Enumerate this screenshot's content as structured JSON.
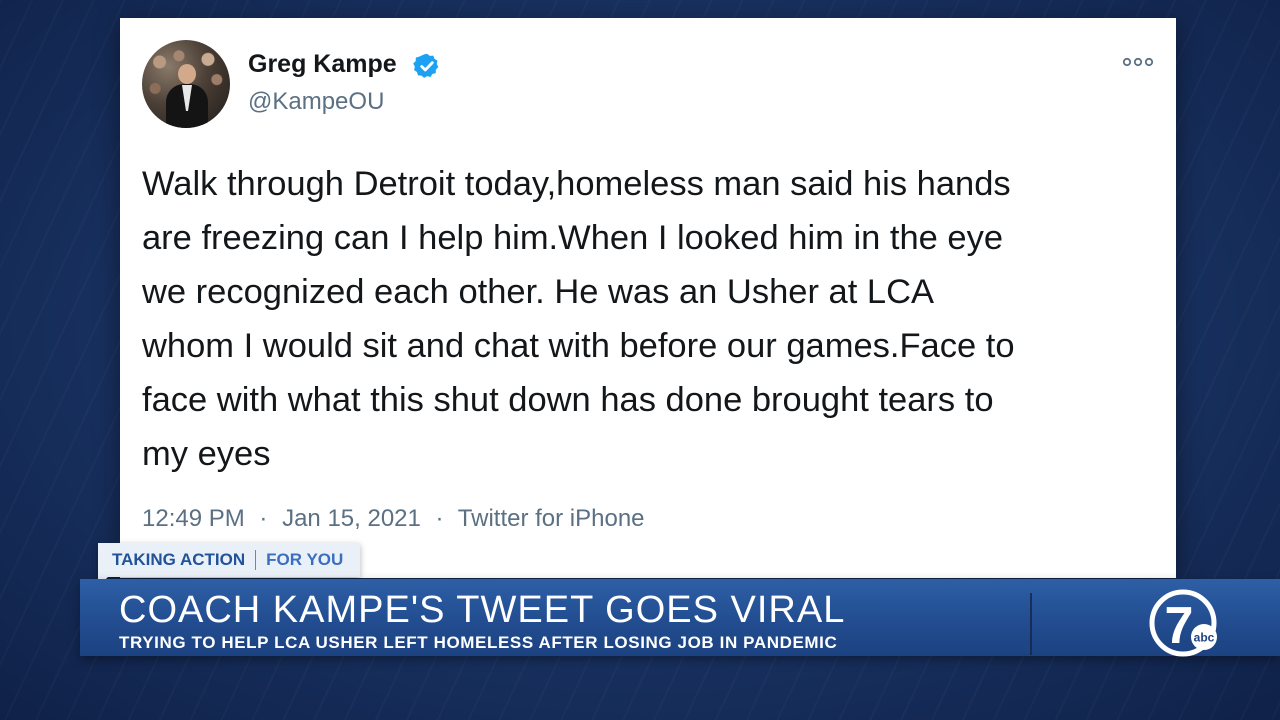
{
  "tweet": {
    "user_name": "Greg Kampe",
    "user_handle": "@KampeOU",
    "text": "Walk through Detroit today,homeless man said his hands\nare freezing can I help him.When I looked him in the eye\nwe recognized each other. He was an Usher at LCA\nwhom I would sit and chat with before our games.Face to\nface with what this shut down has done brought tears to\nmy eyes",
    "time": "12:49 PM",
    "date": "Jan 15, 2021",
    "source": "Twitter for iPhone",
    "separator": "·",
    "verified_color": "#1da1f2"
  },
  "banner": {
    "tag_primary": "TAKING ACTION",
    "tag_secondary": "FOR YOU",
    "headline": "COACH KAMPE'S TWEET GOES VIRAL",
    "subhead": "TRYING TO HELP LCA USHER LEFT HOMELESS AFTER LOSING JOB IN PANDEMIC"
  },
  "logo": {
    "number": "7",
    "network": "abc"
  },
  "colors": {
    "background": "#1b3566",
    "banner": "#224d90",
    "tag_text": "#21529a"
  }
}
